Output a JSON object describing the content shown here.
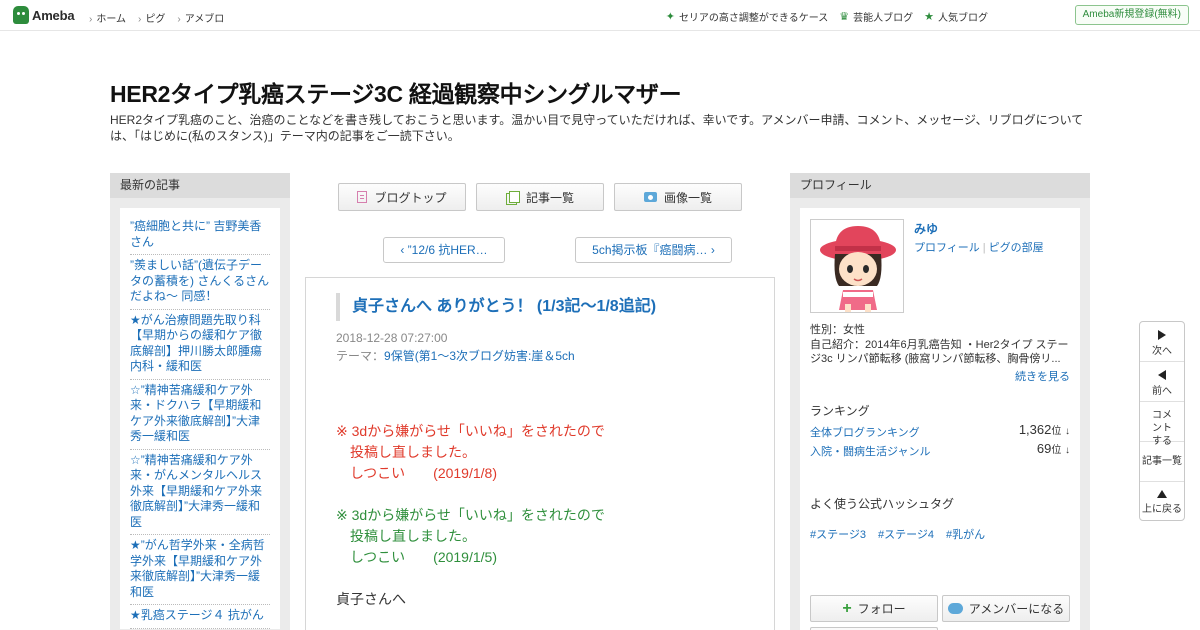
{
  "global_nav": {
    "logo": "Ameba",
    "links": [
      "ホーム",
      "ピグ",
      "アメブロ"
    ],
    "right_links": [
      "セリアの高さ調整ができるケース",
      "芸能人ブログ",
      "人気ブログ"
    ],
    "signup": "Ameba新規登録(無料)"
  },
  "header": {
    "title": "HER2タイプ乳癌ステージ3C 経過観察中シングルマザー",
    "description": "HER2タイプ乳癌のこと、治癌のことなどを書き残しておこうと思います。温かい目で見守っていただければ、幸いです。アメンバー申請、コメント、メッセージ、リブログについては、「はじめに(私のスタンス)」テーマ内の記事をご一読下さい。"
  },
  "sidebar_left": {
    "heading": "最新の記事",
    "items": [
      "”癌細胞と共に” 吉野美香さん",
      "”羨ましい話”(遺伝子データの蓄積を) さんくるさんだよね～ 同感！",
      "★がん治療問題先取り科【早期からの緩和ケア徹底解剖】押川勝太郎腫瘍内科・緩和医",
      "☆”精神苦痛緩和ケア外来・ドクハラ【早期緩和ケア外来徹底解剖】”大津秀一緩和医",
      "☆”精神苦痛緩和ケア外来・がんメンタルヘルス外来【早期緩和ケア外来徹底解剖】”大津秀一緩和医",
      "★”がん哲学外来・全病哲学外来【早期緩和ケア外来徹底解剖】”大津秀一緩和医",
      "★乳癌ステージ４ 抗がん"
    ]
  },
  "blog_nav": {
    "top": "ブログトップ",
    "list": "記事一覧",
    "images": "画像一覧"
  },
  "pager": {
    "prev": "”12/6 抗HER…",
    "next": "5ch掲示板『癌闘病…"
  },
  "article": {
    "title": "貞子さんへ ありがとう！ (1/3記～1/8追記)",
    "date": "2018-12-28 07:27:00",
    "theme_label": "テーマ：",
    "theme": "9保管(第1～3次ブログ妨害:崖＆5ch",
    "note1": [
      "※  3dから嫌がらせ「いいね」をされたので",
      "　投稿し直しました。",
      "　しつこい　　(2019/1/8)"
    ],
    "note2": [
      "※  3dから嫌がらせ「いいね」をされたので",
      "　投稿し直しました。",
      "　しつこい　　(2019/1/5)"
    ],
    "salutation": "貞子さんへ"
  },
  "profile": {
    "heading": "プロフィール",
    "name": "みゆ",
    "link_profile": "プロフィール",
    "link_pig": "ピグの部屋",
    "gender": "性別：女性",
    "intro": "自己紹介：2014年6月乳癌告知 ・Her2タイプ ステージ3c リンパ節転移 (腋窩リンパ節転移、胸骨傍リ...",
    "more": "続きを見る",
    "ranking_heading": "ランキング",
    "rankings": [
      {
        "label": "全体ブログランキング",
        "value": "1,362",
        "unit": "位",
        "arrow": "↓"
      },
      {
        "label": "入院・闘病生活ジャンル",
        "value": "69",
        "unit": "位",
        "arrow": "↓"
      }
    ],
    "hashtag_heading": "よく使う公式ハッシュタグ",
    "hashtags": [
      "#ステージ3",
      "#ステージ4",
      "#乳がん"
    ],
    "follow": "フォロー",
    "amember": "アメンバーになる"
  },
  "float_nav": {
    "next": "次へ",
    "prev": "前へ",
    "comment": "コメントする",
    "list": "記事一覧",
    "top": "上に戻る"
  },
  "colors": {
    "accent_green": "#2d8c3c",
    "link_blue": "#1d6fb8",
    "notice_red": "#e03a2b",
    "notice_green": "#2f8f3c"
  }
}
